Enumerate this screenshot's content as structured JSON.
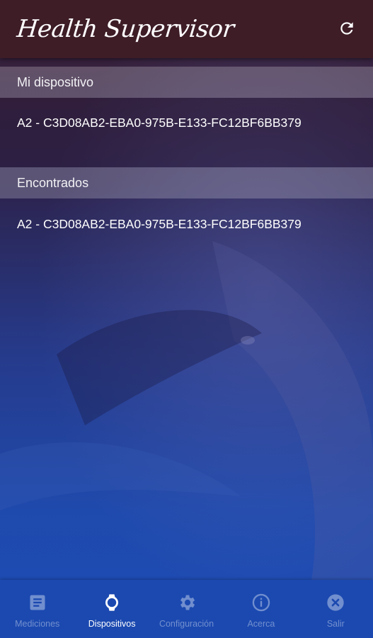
{
  "app": {
    "title": "Health Supervisor",
    "refresh_icon": "refresh-icon"
  },
  "sections": {
    "mine": {
      "header": "Mi dispositivo",
      "device": "A2 - C3D08AB2-EBA0-975B-E133-FC12BF6BB379"
    },
    "found": {
      "header": "Encontrados",
      "device": "A2 - C3D08AB2-EBA0-975B-E133-FC12BF6BB379"
    }
  },
  "nav": {
    "items": [
      {
        "label": "Mediciones",
        "icon": "document-icon",
        "active": false
      },
      {
        "label": "Dispositivos",
        "icon": "watch-icon",
        "active": true
      },
      {
        "label": "Configuración",
        "icon": "gear-icon",
        "active": false
      },
      {
        "label": "Acerca",
        "icon": "info-icon",
        "active": false
      },
      {
        "label": "Salir",
        "icon": "close-circle-icon",
        "active": false
      }
    ]
  },
  "colors": {
    "app_bar": "#3e1d27",
    "nav_bar": "#1b49b0",
    "active_label": "#ffffff",
    "inactive_label": "rgba(255,255,255,0.38)"
  }
}
